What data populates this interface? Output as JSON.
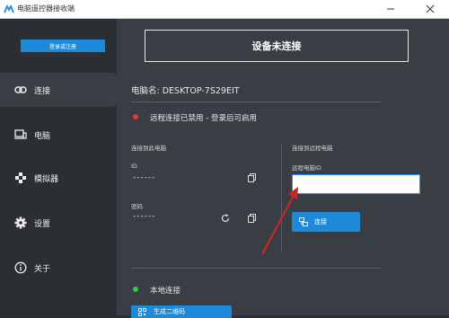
{
  "window": {
    "title": "电脑遥控器接收端"
  },
  "sidebar": {
    "login_label": "登录或注册",
    "items": [
      {
        "label": "连接",
        "icon": "link-icon"
      },
      {
        "label": "电脑",
        "icon": "computer-icon"
      },
      {
        "label": "模拟器",
        "icon": "gamepad-icon"
      },
      {
        "label": "设置",
        "icon": "gear-icon"
      },
      {
        "label": "关于",
        "icon": "info-icon"
      }
    ]
  },
  "main": {
    "status_title": "设备未连接",
    "computer_name": "电脑名: DESKTOP-7S29EIT",
    "remote_status": "远程连接已禁用 - 登录后可启用",
    "left_panel": {
      "heading": "连接到此电脑",
      "id_label": "ID",
      "id_value": "------",
      "password_label": "密码",
      "password_value": "------"
    },
    "right_panel": {
      "heading": "连接到远程电脑",
      "remote_id_label": "远程电脑ID",
      "remote_id_value": "",
      "connect_label": "连接"
    },
    "local_connection": "本地连接",
    "generate_button": "生成二维码"
  },
  "colors": {
    "accent": "#1e88d9",
    "status_red": "#e53935",
    "status_green": "#2ecc40",
    "annotation_arrow": "#c62828"
  }
}
